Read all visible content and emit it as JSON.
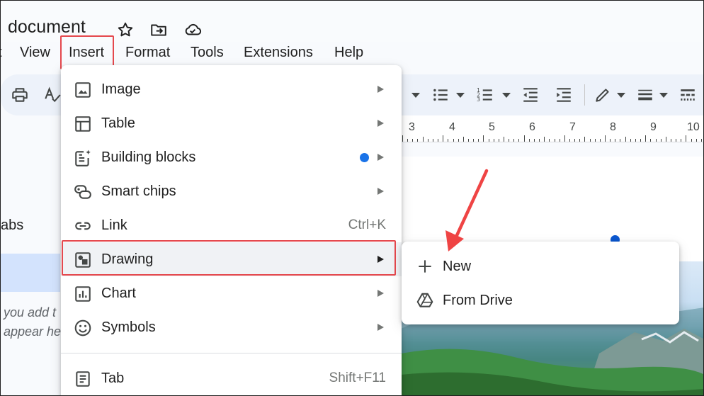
{
  "document": {
    "title": "document"
  },
  "menubar": {
    "items": [
      "t",
      "View",
      "Insert",
      "Format",
      "Tools",
      "Extensions",
      "Help"
    ]
  },
  "left_panel": {
    "tabs_label": "abs",
    "hint_line1": "you add t",
    "hint_line2": "appear he"
  },
  "ruler": {
    "numbers": [
      "3",
      "4",
      "5",
      "6",
      "7",
      "8",
      "9",
      "10"
    ]
  },
  "insert_menu": {
    "items": [
      {
        "label": "Image",
        "icon": "image-icon",
        "submenu": true
      },
      {
        "label": "Table",
        "icon": "table-icon",
        "submenu": true
      },
      {
        "label": "Building blocks",
        "icon": "building-blocks-icon",
        "submenu": true,
        "new_badge": true
      },
      {
        "label": "Smart chips",
        "icon": "smart-chips-icon",
        "submenu": true
      },
      {
        "label": "Link",
        "icon": "link-icon",
        "shortcut": "Ctrl+K"
      },
      {
        "label": "Drawing",
        "icon": "drawing-icon",
        "submenu": true,
        "highlighted": true
      },
      {
        "label": "Chart",
        "icon": "chart-icon",
        "submenu": true
      },
      {
        "label": "Symbols",
        "icon": "symbols-icon",
        "submenu": true
      },
      {
        "label": "Tab",
        "icon": "tab-icon",
        "shortcut": "Shift+F11"
      }
    ]
  },
  "drawing_submenu": {
    "items": [
      {
        "label": "New",
        "icon": "plus-icon"
      },
      {
        "label": "From Drive",
        "icon": "drive-icon"
      }
    ]
  },
  "colors": {
    "annotation_red": "#e5484d",
    "accent_blue": "#1a73e8",
    "toolbar_bg": "#edf2fa"
  }
}
